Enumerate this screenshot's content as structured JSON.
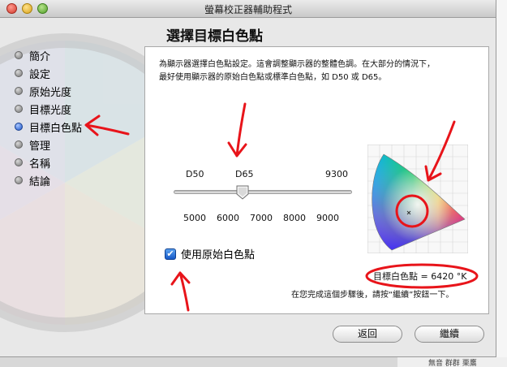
{
  "window": {
    "title": "螢幕校正器輔助程式"
  },
  "page": {
    "title": "選擇目標白色點"
  },
  "sidebar": {
    "items": [
      {
        "label": "簡介",
        "active": false
      },
      {
        "label": "設定",
        "active": false
      },
      {
        "label": "原始光度",
        "active": false
      },
      {
        "label": "目標光度",
        "active": false
      },
      {
        "label": "目標白色點",
        "active": true
      },
      {
        "label": "管理",
        "active": false
      },
      {
        "label": "名稱",
        "active": false
      },
      {
        "label": "結論",
        "active": false
      }
    ]
  },
  "panel": {
    "description_line1": "為顯示器選擇白色點設定。這會調整顯示器的整體色調。在大部分的情況下，",
    "description_line2": "最好使用顯示器的原始白色點或標準白色點，如 D50 或 D65。",
    "slider": {
      "top_labels": [
        "D50",
        "D65",
        "9300"
      ],
      "bottom_labels": [
        "5000",
        "6000",
        "7000",
        "8000",
        "9000"
      ],
      "value": 6420
    },
    "checkbox": {
      "label": "使用原始白色點",
      "checked": true,
      "mark": "✔"
    },
    "target_readout": "目標白色點 = 6420 °K",
    "instruction": "在您完成這個步驟後，請按“繼續”按鈕一下。"
  },
  "buttons": {
    "back": "返回",
    "continue": "繼續"
  },
  "background_window": {
    "partial_text": "無音   群群   栗鷹"
  },
  "colors": {
    "accent": "#1d55c9",
    "annotation": "#e8141a"
  }
}
